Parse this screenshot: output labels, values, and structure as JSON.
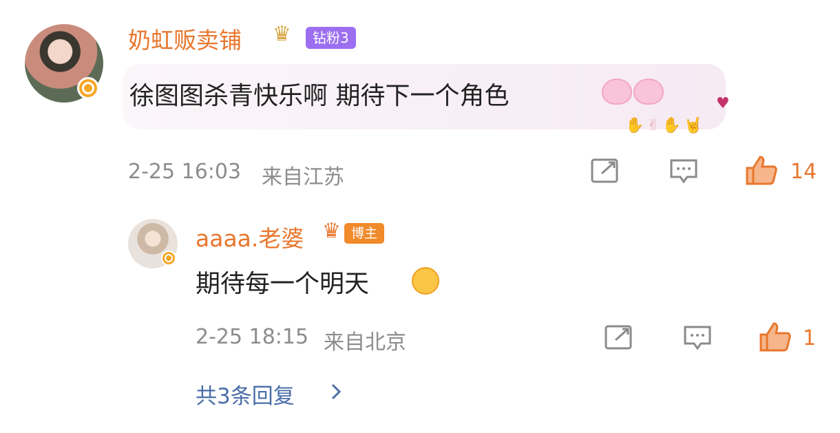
{
  "comment": {
    "username": "奶虹贩卖铺",
    "fan_badge": "钻粉3",
    "text": "徐图图杀青快乐啊 期待下一个角色",
    "timestamp": "2-25 16:03",
    "location": "来自江苏",
    "like_count": "14",
    "emojis": [
      "bunny-emoji",
      "bunny-emoji"
    ],
    "decorations": [
      "heart-icon",
      "hands-icon"
    ]
  },
  "reply": {
    "username": "aaaa.老婆",
    "author_badge": "博主",
    "text": "期待每一个明天",
    "timestamp": "2-25 18:15",
    "location": "来自北京",
    "like_count": "1",
    "emoji": "hug-face-emoji"
  },
  "more_replies": {
    "label": "共3条回复"
  },
  "colors": {
    "username": "#e8762c",
    "like": "#e8762c",
    "link": "#4a6ea8",
    "meta": "#8c8c8c",
    "fan_badge_bg": "#9b6ff0",
    "host_badge_bg": "#f08a2a"
  }
}
